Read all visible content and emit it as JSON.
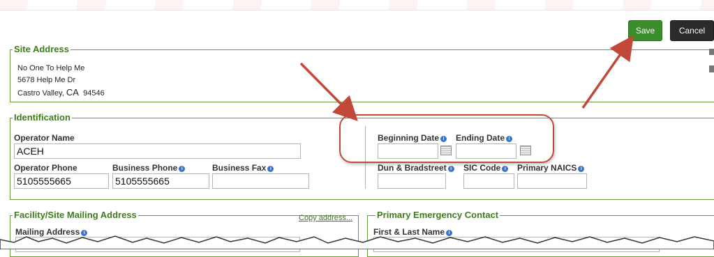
{
  "toolbar": {
    "save_label": "Save",
    "cancel_label": "Cancel"
  },
  "site_address": {
    "legend": "Site Address",
    "lines": [
      "No One To Help Me",
      "5678 Help Me Dr",
      "Castro Valley, CA 94546"
    ],
    "city_state": "Castro Valley,",
    "state": "CA",
    "zip": "94546"
  },
  "identification": {
    "legend": "Identification",
    "operator_name_label": "Operator Name",
    "operator_name_value": "ACEH",
    "operator_phone_label": "Operator Phone",
    "operator_phone_value": "5105555665",
    "business_phone_label": "Business Phone",
    "business_phone_value": "5105555665",
    "business_fax_label": "Business Fax",
    "business_fax_value": "",
    "beginning_date_label": "Beginning Date",
    "beginning_date_value": "",
    "ending_date_label": "Ending Date",
    "ending_date_value": "",
    "dun_label": "Dun & Bradstreet",
    "sic_label": "SIC Code",
    "naics_label": "Primary NAICS"
  },
  "mailing": {
    "legend": "Facility/Site Mailing Address",
    "copy_link": "Copy address...",
    "mailing_address_label": "Mailing Address"
  },
  "emergency": {
    "legend": "Primary Emergency Contact",
    "name_label": "First & Last Name"
  },
  "icons": {
    "info": "info-icon",
    "calendar": "calendar-icon",
    "arrow": "annotation-arrow"
  },
  "colors": {
    "accent_green": "#3f7a1f",
    "save_button": "#3b8c2a",
    "cancel_button": "#2b2b2b",
    "annotation_red": "#c2483a",
    "info_blue": "#3a74c8"
  }
}
